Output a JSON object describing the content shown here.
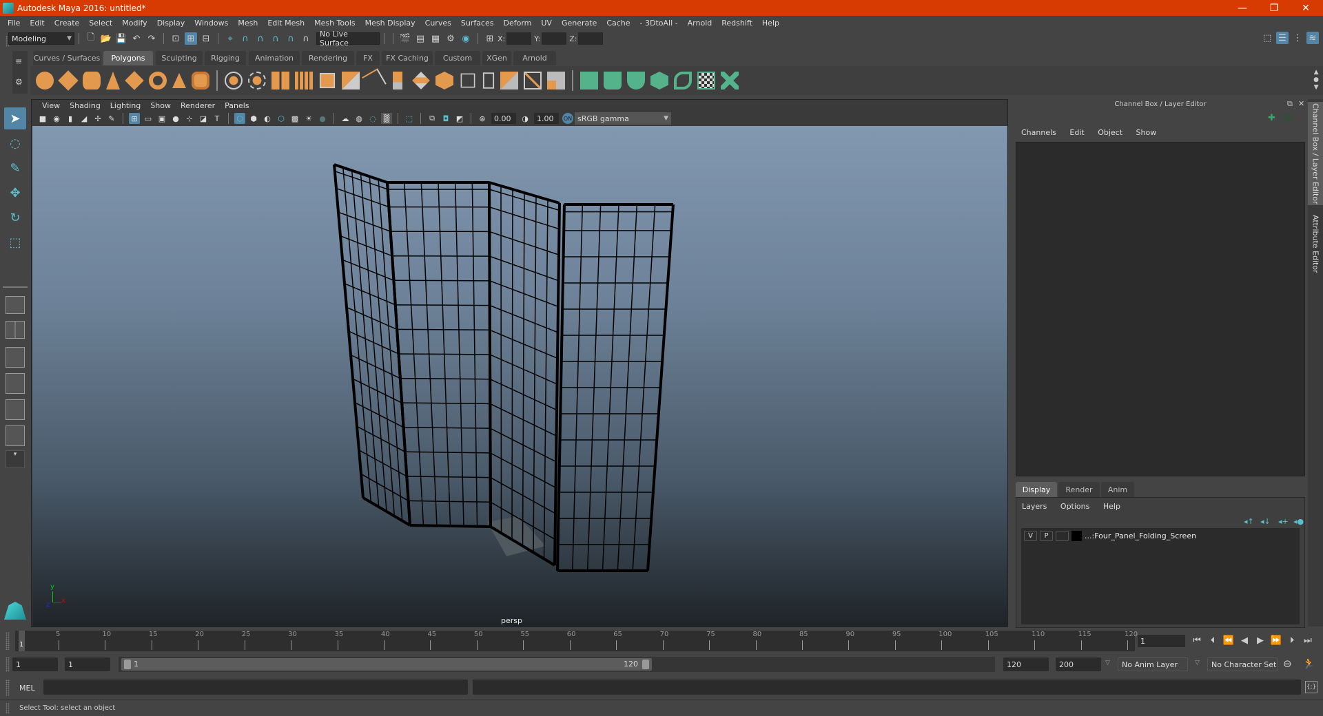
{
  "window": {
    "title": "Autodesk Maya 2016: untitled*",
    "controls": [
      "minimize-icon",
      "restore-icon",
      "close-icon"
    ]
  },
  "menubar": [
    "File",
    "Edit",
    "Create",
    "Select",
    "Modify",
    "Display",
    "Windows",
    "Mesh",
    "Edit Mesh",
    "Mesh Tools",
    "Mesh Display",
    "Curves",
    "Surfaces",
    "Deform",
    "UV",
    "Generate",
    "Cache",
    "- 3DtoAll -",
    "Arnold",
    "Redshift",
    "Help"
  ],
  "statusline": {
    "workspace": "Modeling",
    "live_surface": "No Live Surface",
    "x_label": "X:",
    "y_label": "Y:",
    "z_label": "Z:",
    "x_value": "",
    "y_value": "",
    "z_value": ""
  },
  "shelf": {
    "tabs": [
      "Curves / Surfaces",
      "Polygons",
      "Sculpting",
      "Rigging",
      "Animation",
      "Rendering",
      "FX",
      "FX Caching",
      "Custom",
      "XGen",
      "Arnold"
    ],
    "active_tab": "Polygons",
    "icons": [
      "poly-sphere-icon",
      "poly-cube-icon",
      "poly-cylinder-icon",
      "poly-cone-icon",
      "poly-plane-icon",
      "poly-torus-icon",
      "poly-pyramid-icon",
      "poly-pipe-icon",
      "combine-icon",
      "separate-icon",
      "mirror-icon",
      "smooth-icon",
      "extract-icon",
      "bevel-icon",
      "bridge-icon",
      "extrude-icon",
      "append-icon",
      "multi-cut-icon",
      "target-weld-icon",
      "insert-edge-loop-icon",
      "offset-edge-loop-icon",
      "merge-icon",
      "collapse-icon",
      "planar-uv-icon",
      "cylindrical-uv-icon",
      "spherical-uv-icon",
      "automatic-uv-icon",
      "unfold-uv-icon",
      "uv-editor-icon",
      "cut-sew-uv-icon"
    ]
  },
  "viewport": {
    "menu": [
      "View",
      "Shading",
      "Lighting",
      "Show",
      "Renderer",
      "Panels"
    ],
    "exposure": "0.00",
    "gamma": "1.00",
    "color_management": "sRGB gamma",
    "camera": "persp",
    "axis": {
      "x": "x",
      "y": "y",
      "z": "z"
    },
    "background_top": "#8298b0",
    "background_bottom": "#1e2327"
  },
  "channel_box": {
    "title": "Channel Box / Layer Editor",
    "menu": [
      "Channels",
      "Edit",
      "Object",
      "Show"
    ]
  },
  "layer_editor": {
    "tabs": [
      "Display",
      "Render",
      "Anim"
    ],
    "active_tab": "Display",
    "menu": [
      "Layers",
      "Options",
      "Help"
    ],
    "layers": [
      {
        "visible": "V",
        "playback": "P",
        "name": "...:Four_Panel_Folding_Screen",
        "color": "#000000"
      }
    ]
  },
  "side_tabs": [
    "Channel Box / Layer Editor",
    "Attribute Editor"
  ],
  "timeline": {
    "ticks": [
      5,
      10,
      15,
      20,
      25,
      30,
      35,
      40,
      45,
      50,
      55,
      60,
      65,
      70,
      75,
      80,
      85,
      90,
      95,
      100,
      105,
      110,
      115,
      120
    ],
    "start": 1,
    "end": 120,
    "current_frame_marker": "1",
    "current_frame": "1"
  },
  "range": {
    "start_time": "1",
    "playback_start": "1",
    "slider_start": "1",
    "slider_end": "120",
    "playback_end": "120",
    "end_time": "200",
    "anim_layer": "No Anim Layer",
    "character_set": "No Character Set"
  },
  "command_line": {
    "language": "MEL",
    "value": ""
  },
  "help_line": "Select Tool: select an object",
  "colors": {
    "title_bar": "#d83b01",
    "accent": "#5285a6",
    "shelf_orange": "#e39a4f",
    "shelf_green": "#55b38c",
    "tool_cyan": "#58c0cf"
  }
}
